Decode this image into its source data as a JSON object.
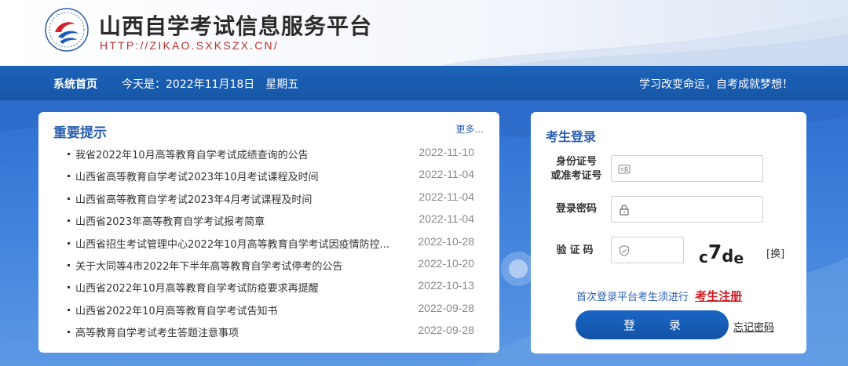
{
  "header": {
    "title": "山西自学考试信息服务平台",
    "url_text": "HTTP://ZIKAO.SXKSZX.CN/",
    "logo_icon": "exam-logo-icon"
  },
  "navbar": {
    "home": "系统首页",
    "date": "今天是：2022年11月18日　星期五",
    "slogan": "学习改变命运，自考成就梦想！"
  },
  "notices": {
    "title": "重要提示",
    "more": "更多...",
    "items": [
      {
        "text": "我省2022年10月高等教育自学考试成绩查询的公告",
        "date": "2022-11-10"
      },
      {
        "text": "山西省高等教育自学考试2023年10月考试课程及时间",
        "date": "2022-11-04"
      },
      {
        "text": "山西省高等教育自学考试2023年4月考试课程及时间",
        "date": "2022-11-04"
      },
      {
        "text": "山西省2023年高等教育自学考试报考简章",
        "date": "2022-11-04"
      },
      {
        "text": "山西省招生考试管理中心2022年10月高等教育自学考试因疫情防控...",
        "date": "2022-10-28"
      },
      {
        "text": "关于大同等4市2022年下半年高等教育自学考试停考的公告",
        "date": "2022-10-20"
      },
      {
        "text": "山西省2022年10月高等教育自学考试防疫要求再提醒",
        "date": "2022-10-13"
      },
      {
        "text": "山西省2022年10月高等教育自学考试告知书",
        "date": "2022-09-28"
      },
      {
        "text": "高等教育自学考试考生答题注意事项",
        "date": "2022-09-28"
      }
    ]
  },
  "login": {
    "title": "考生登录",
    "id_label_line1": "身份证号",
    "id_label_line2": "或准考证号",
    "password_label": "登录密码",
    "captcha_label": "验证码",
    "captcha_text": [
      "c",
      "7",
      "d",
      "e"
    ],
    "refresh": "[换]",
    "register_prompt": "首次登录平台考生须进行",
    "register_link": "考生注册",
    "login_button": "登　录",
    "forgot": "忘记密码",
    "icons": {
      "id": "id-card-icon",
      "password": "lock-icon",
      "captcha": "shield-icon"
    }
  },
  "colors": {
    "brand_blue": "#1656a6",
    "accent_red": "#d0191f",
    "title_blue": "#2b5fb0"
  }
}
